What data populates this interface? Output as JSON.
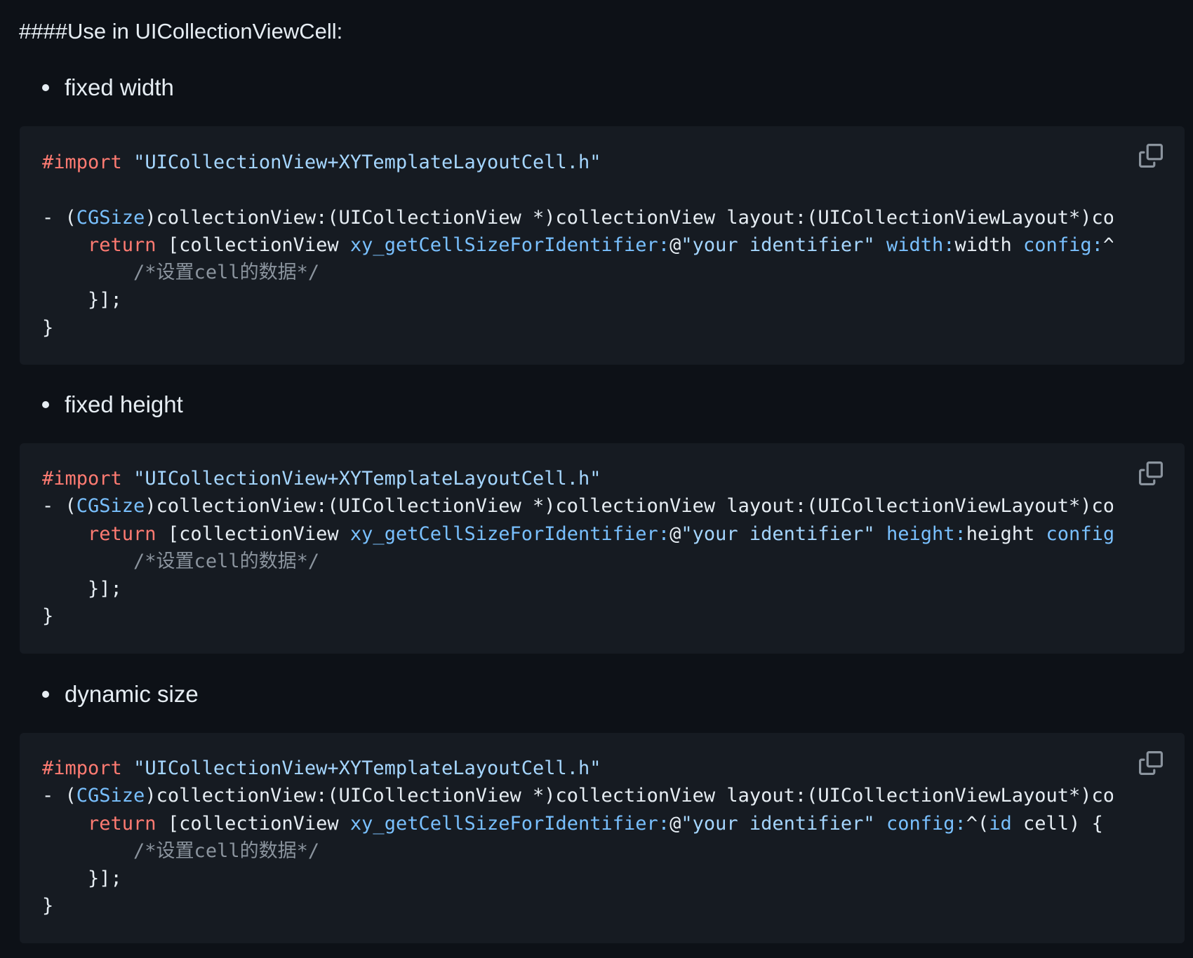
{
  "heading": "####Use in UICollectionViewCell:",
  "sections": [
    {
      "bullet": "fixed width",
      "copy_icon": "copy-icon",
      "code_lines": [
        [
          [
            "kw",
            "#import"
          ],
          [
            "pl",
            " "
          ],
          [
            "str",
            "\"UICollectionView+XYTemplateLayoutCell.h\""
          ]
        ],
        [],
        [
          [
            "pl",
            "- ("
          ],
          [
            "type",
            "CGSize"
          ],
          [
            "pl",
            ")collectionView:(UICollectionView *)collectionView layout:(UICollectionViewLayout*)co"
          ]
        ],
        [
          [
            "pl",
            "    "
          ],
          [
            "kw",
            "return"
          ],
          [
            "pl",
            " [collectionView "
          ],
          [
            "fn",
            "xy_getCellSizeForIdentifier:"
          ],
          [
            "pl",
            "@"
          ],
          [
            "str",
            "\"your identifier\""
          ],
          [
            "pl",
            " "
          ],
          [
            "fn",
            "width:"
          ],
          [
            "pl",
            "width "
          ],
          [
            "fn",
            "config:"
          ],
          [
            "pl",
            "^"
          ]
        ],
        [
          [
            "pl",
            "        "
          ],
          [
            "cm",
            "/*设置cell的数据*/"
          ]
        ],
        [
          [
            "pl",
            "    }];"
          ]
        ],
        [
          [
            "pl",
            "}"
          ]
        ]
      ]
    },
    {
      "bullet": "fixed height",
      "copy_icon": "copy-icon",
      "code_lines": [
        [
          [
            "kw",
            "#import"
          ],
          [
            "pl",
            " "
          ],
          [
            "str",
            "\"UICollectionView+XYTemplateLayoutCell.h\""
          ]
        ],
        [
          [
            "pl",
            "- ("
          ],
          [
            "type",
            "CGSize"
          ],
          [
            "pl",
            ")collectionView:(UICollectionView *)collectionView layout:(UICollectionViewLayout*)co"
          ]
        ],
        [
          [
            "pl",
            "    "
          ],
          [
            "kw",
            "return"
          ],
          [
            "pl",
            " [collectionView "
          ],
          [
            "fn",
            "xy_getCellSizeForIdentifier:"
          ],
          [
            "pl",
            "@"
          ],
          [
            "str",
            "\"your identifier\""
          ],
          [
            "pl",
            " "
          ],
          [
            "fn",
            "height:"
          ],
          [
            "pl",
            "height "
          ],
          [
            "fn",
            "config"
          ]
        ],
        [
          [
            "pl",
            "        "
          ],
          [
            "cm",
            "/*设置cell的数据*/"
          ]
        ],
        [
          [
            "pl",
            "    }];"
          ]
        ],
        [
          [
            "pl",
            "}"
          ]
        ]
      ]
    },
    {
      "bullet": "dynamic size",
      "copy_icon": "copy-icon",
      "code_lines": [
        [
          [
            "kw",
            "#import"
          ],
          [
            "pl",
            " "
          ],
          [
            "str",
            "\"UICollectionView+XYTemplateLayoutCell.h\""
          ]
        ],
        [
          [
            "pl",
            "- ("
          ],
          [
            "type",
            "CGSize"
          ],
          [
            "pl",
            ")collectionView:(UICollectionView *)collectionView layout:(UICollectionViewLayout*)co"
          ]
        ],
        [
          [
            "pl",
            "    "
          ],
          [
            "kw",
            "return"
          ],
          [
            "pl",
            " [collectionView "
          ],
          [
            "fn",
            "xy_getCellSizeForIdentifier:"
          ],
          [
            "pl",
            "@"
          ],
          [
            "str",
            "\"your identifier\""
          ],
          [
            "pl",
            " "
          ],
          [
            "fn",
            "config:"
          ],
          [
            "pl",
            "^("
          ],
          [
            "type",
            "id"
          ],
          [
            "pl",
            " cell) {"
          ]
        ],
        [
          [
            "pl",
            "        "
          ],
          [
            "cm",
            "/*设置cell的数据*/"
          ]
        ],
        [
          [
            "pl",
            "    }];"
          ]
        ],
        [
          [
            "pl",
            "}"
          ]
        ]
      ]
    }
  ],
  "colors": {
    "background": "#0d1117",
    "code_background": "#161b22",
    "text": "#e6edf3",
    "keyword": "#ff7b72",
    "string": "#a5d6ff",
    "function": "#79c0ff",
    "comment": "#8b949e",
    "icon": "#8b949e"
  }
}
